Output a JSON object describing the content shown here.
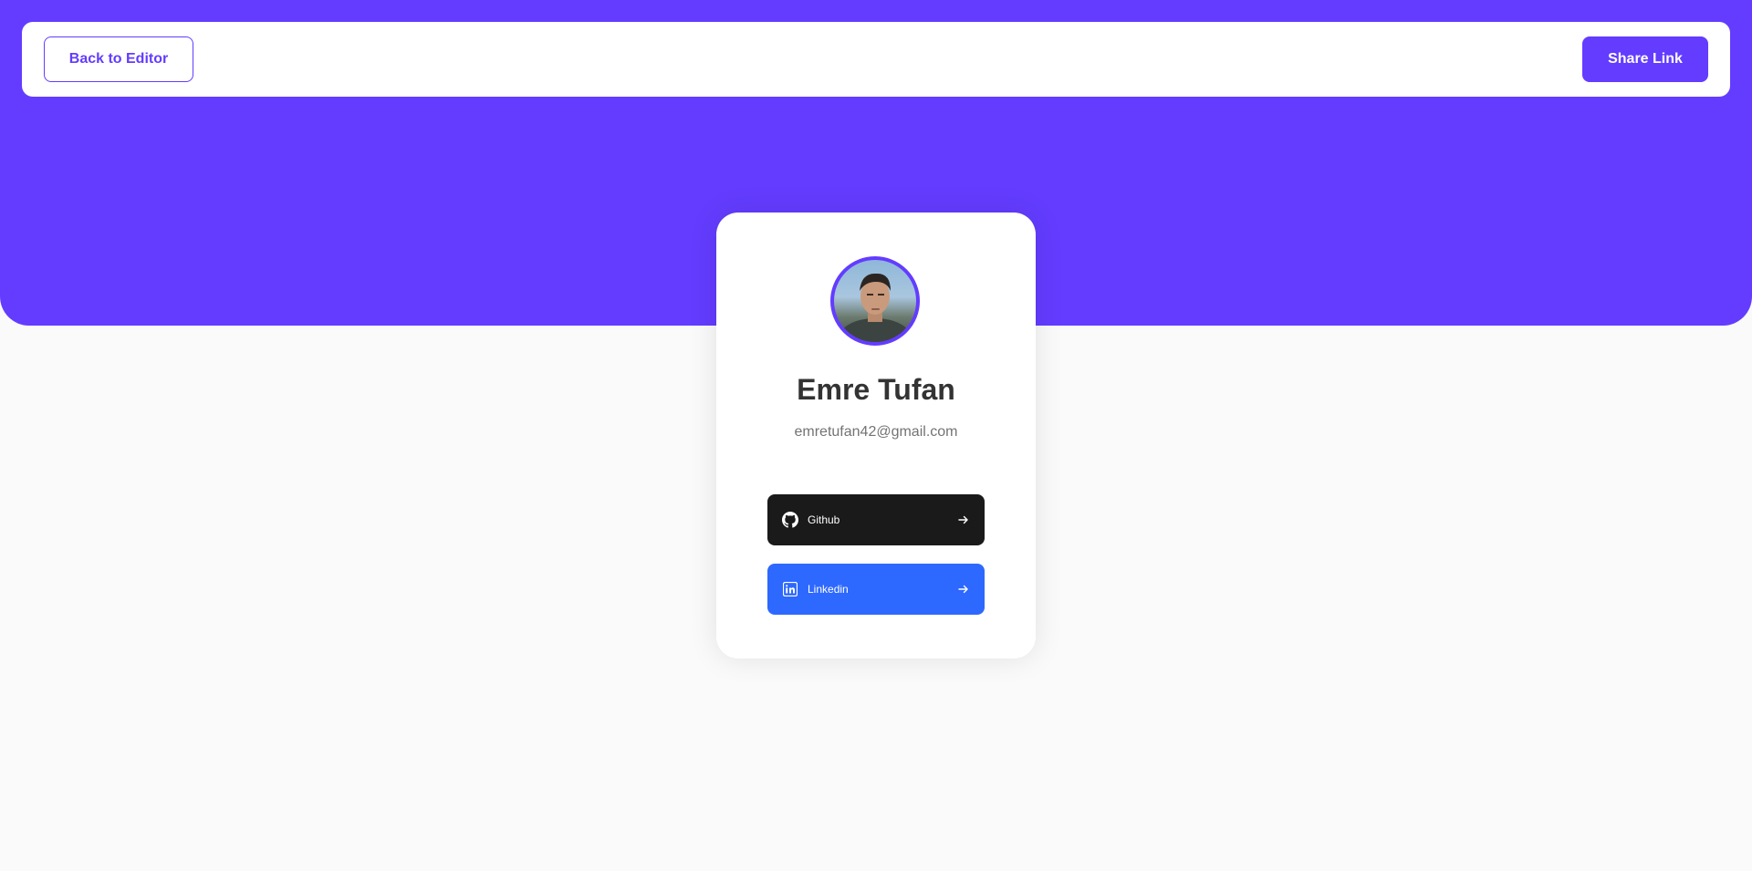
{
  "header": {
    "back_label": "Back to Editor",
    "share_label": "Share Link"
  },
  "profile": {
    "name": "Emre Tufan",
    "email": "emretufan42@gmail.com"
  },
  "links": [
    {
      "platform": "Github",
      "icon": "github-icon",
      "color": "#1a1a1a"
    },
    {
      "platform": "Linkedin",
      "icon": "linkedin-icon",
      "color": "#2d68ff"
    }
  ],
  "colors": {
    "accent": "#633cff",
    "background": "#fafafa",
    "heading": "#333333",
    "muted": "#737373"
  }
}
